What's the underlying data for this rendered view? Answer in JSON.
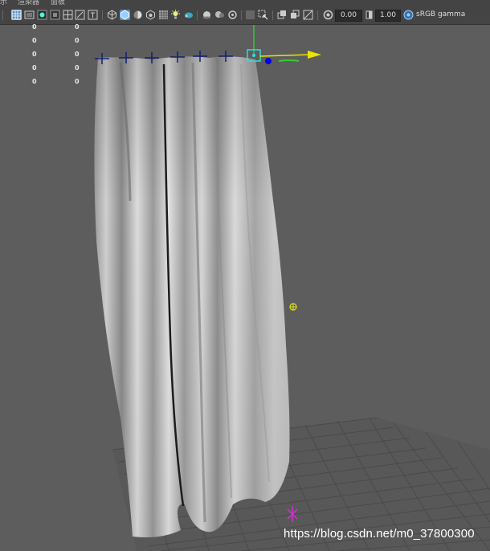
{
  "menu": {
    "items": [
      "示",
      "渲染器",
      "面板"
    ]
  },
  "toolbar": {
    "exposure_value": "0.00",
    "gamma_value": "1.00",
    "color_space": "sRGB gamma",
    "icons": [
      "camera-select-icon",
      "grid-icon",
      "film-gate-icon",
      "resolution-gate-icon",
      "gate-mask-icon",
      "field-chart-icon",
      "safe-action-icon",
      "safe-title-icon",
      "wireframe-icon",
      "smooth-shade-icon",
      "default-material-icon",
      "textured-icon",
      "all-lights-icon",
      "shadows-icon",
      "screen-space-ao-icon",
      "motion-blur-icon",
      "anti-alias-icon",
      "depth-of-field-icon",
      "isolate-select-icon",
      "xray-icon",
      "xray-joints-icon",
      "backface-icon",
      "exposure-icon",
      "gamma-icon",
      "color-management-icon"
    ]
  },
  "hud": {
    "rows": [
      {
        "a": "0",
        "b": "0"
      },
      {
        "a": "0",
        "b": "0"
      },
      {
        "a": "0",
        "b": "0"
      },
      {
        "a": "0",
        "b": "0"
      },
      {
        "a": "0",
        "b": "0"
      }
    ]
  },
  "viewport": {
    "object": "curtain-cloth-mesh",
    "background_color": "#5d5d5d",
    "grid_color": "#4a4a4a",
    "manipulator_colors": {
      "x": "#e6e600",
      "y": "#33cc33",
      "z": "#0000ff"
    }
  },
  "watermark": "https://blog.csdn.net/m0_37800300"
}
